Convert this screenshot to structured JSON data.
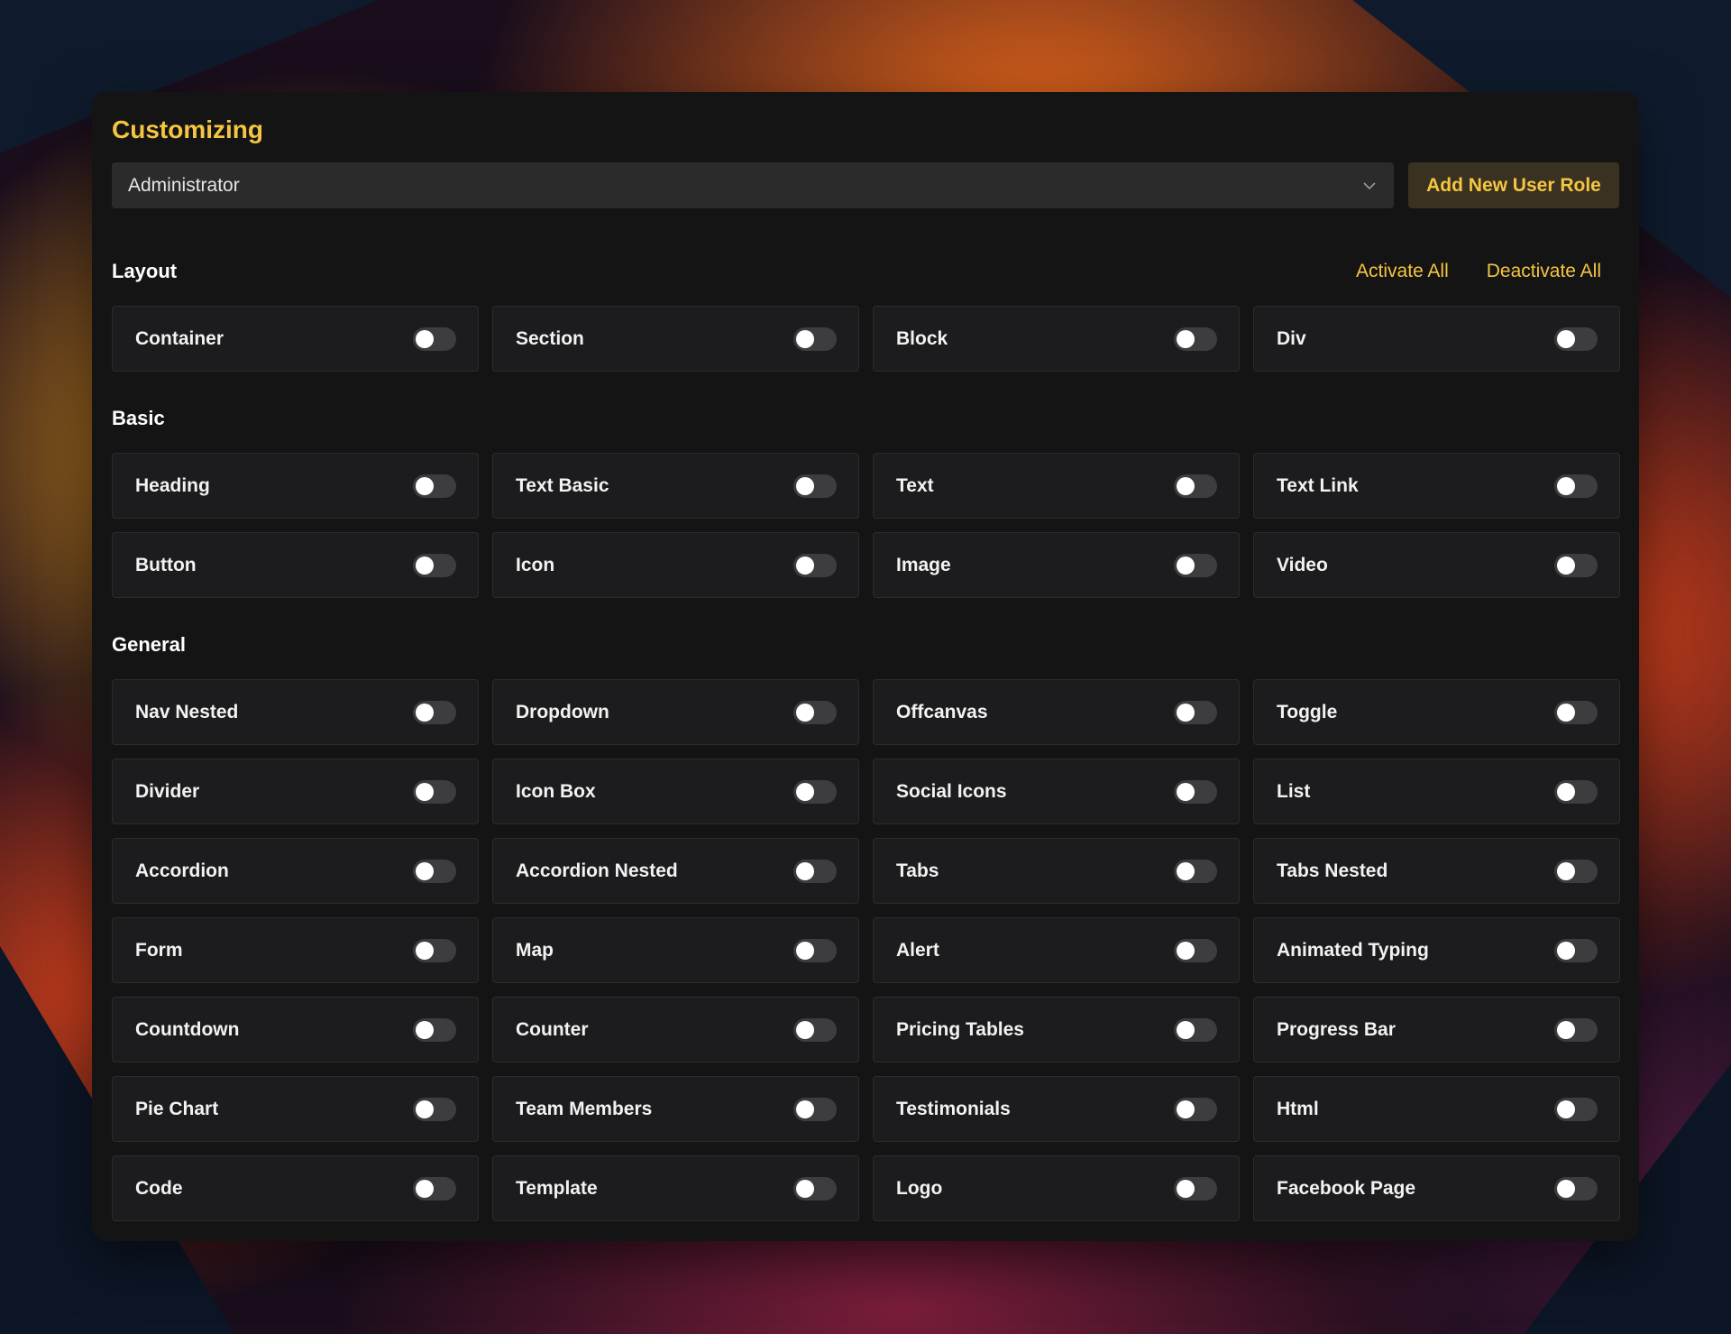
{
  "header": {
    "title": "Customizing",
    "role_select_value": "Administrator",
    "add_role_label": "Add New User Role"
  },
  "actions": {
    "activate_all": "Activate All",
    "deactivate_all": "Deactivate All"
  },
  "sections": [
    {
      "title": "Layout",
      "items": [
        {
          "label": "Container",
          "enabled": false
        },
        {
          "label": "Section",
          "enabled": false
        },
        {
          "label": "Block",
          "enabled": false
        },
        {
          "label": "Div",
          "enabled": false
        }
      ]
    },
    {
      "title": "Basic",
      "items": [
        {
          "label": "Heading",
          "enabled": false
        },
        {
          "label": "Text Basic",
          "enabled": false
        },
        {
          "label": "Text",
          "enabled": false
        },
        {
          "label": "Text Link",
          "enabled": false
        },
        {
          "label": "Button",
          "enabled": false
        },
        {
          "label": "Icon",
          "enabled": false
        },
        {
          "label": "Image",
          "enabled": false
        },
        {
          "label": "Video",
          "enabled": false
        }
      ]
    },
    {
      "title": "General",
      "items": [
        {
          "label": "Nav Nested",
          "enabled": false
        },
        {
          "label": "Dropdown",
          "enabled": false
        },
        {
          "label": "Offcanvas",
          "enabled": false
        },
        {
          "label": "Toggle",
          "enabled": false
        },
        {
          "label": "Divider",
          "enabled": false
        },
        {
          "label": "Icon Box",
          "enabled": false
        },
        {
          "label": "Social Icons",
          "enabled": false
        },
        {
          "label": "List",
          "enabled": false
        },
        {
          "label": "Accordion",
          "enabled": false
        },
        {
          "label": "Accordion Nested",
          "enabled": false
        },
        {
          "label": "Tabs",
          "enabled": false
        },
        {
          "label": "Tabs Nested",
          "enabled": false
        },
        {
          "label": "Form",
          "enabled": false
        },
        {
          "label": "Map",
          "enabled": false
        },
        {
          "label": "Alert",
          "enabled": false
        },
        {
          "label": "Animated Typing",
          "enabled": false
        },
        {
          "label": "Countdown",
          "enabled": false
        },
        {
          "label": "Counter",
          "enabled": false
        },
        {
          "label": "Pricing Tables",
          "enabled": false
        },
        {
          "label": "Progress Bar",
          "enabled": false
        },
        {
          "label": "Pie Chart",
          "enabled": false
        },
        {
          "label": "Team Members",
          "enabled": false
        },
        {
          "label": "Testimonials",
          "enabled": false
        },
        {
          "label": "Html",
          "enabled": false
        },
        {
          "label": "Code",
          "enabled": false
        },
        {
          "label": "Template",
          "enabled": false
        },
        {
          "label": "Logo",
          "enabled": false
        },
        {
          "label": "Facebook Page",
          "enabled": false
        }
      ]
    }
  ],
  "colors": {
    "accent": "#f5c542",
    "panel_bg": "#141414",
    "card_bg": "#1c1c1e",
    "toggle_off": "#3d3d40"
  }
}
